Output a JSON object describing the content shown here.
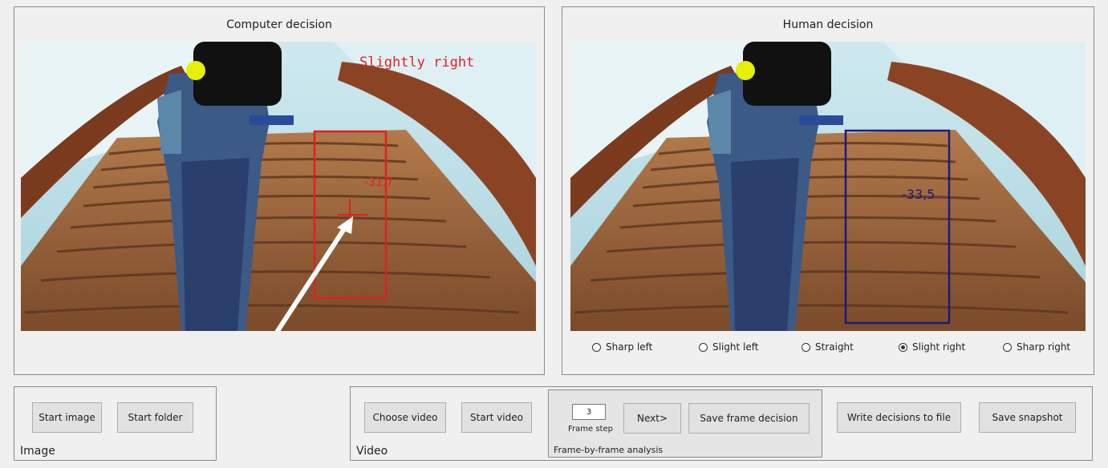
{
  "computer_panel": {
    "title": "Computer decision",
    "overlay_text": "Slightly right",
    "box_value": "-31,7",
    "colors": {
      "overlay": "#e02020",
      "arrow": "#ffffff"
    }
  },
  "human_panel": {
    "title": "Human decision",
    "box_value": "-33,5",
    "colors": {
      "box": "#1a1a7a"
    },
    "options": [
      {
        "label": "Sharp left",
        "checked": false
      },
      {
        "label": "Slight left",
        "checked": false
      },
      {
        "label": "Straight",
        "checked": false
      },
      {
        "label": "Slight right",
        "checked": true
      },
      {
        "label": "Sharp right",
        "checked": false
      }
    ]
  },
  "image_group": {
    "label": "Image",
    "start_image": "Start image",
    "start_folder": "Start folder"
  },
  "video_group": {
    "label": "Video",
    "choose_video": "Choose video",
    "start_video": "Start video"
  },
  "frame_group": {
    "label": "Frame-by-frame analysis",
    "frame_step_value": "3",
    "frame_step_label": "Frame step",
    "next": "Next>",
    "save_frame_decision": "Save frame decision"
  },
  "actions": {
    "write_decisions": "Write decisions to file",
    "save_snapshot": "Save snapshot"
  }
}
